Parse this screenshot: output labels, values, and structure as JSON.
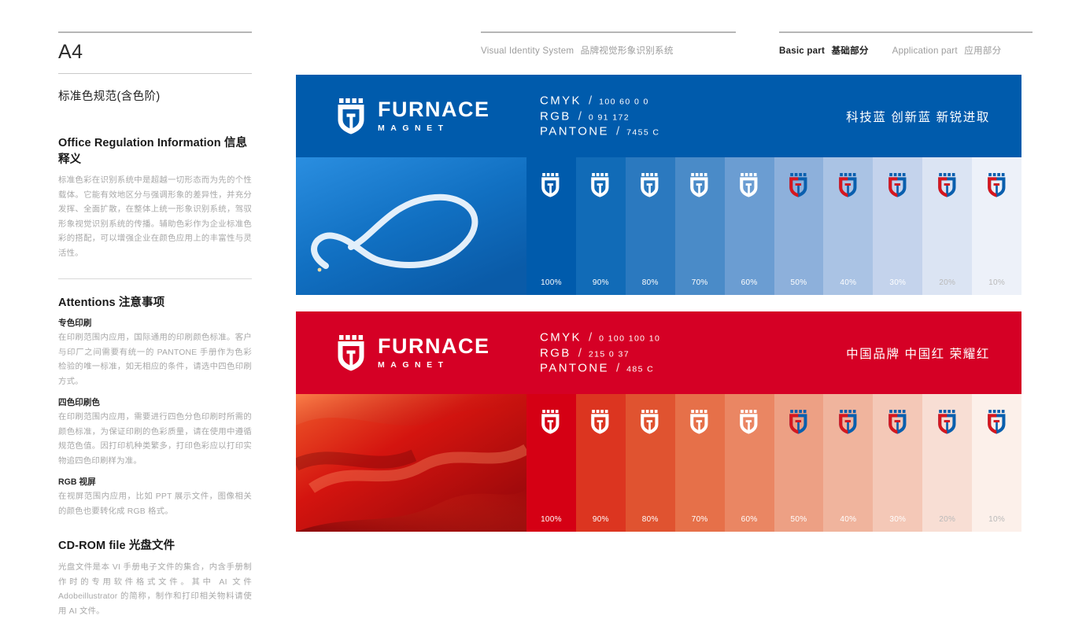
{
  "left": {
    "page_size": "A4",
    "section_title": "标准色规范(含色阶)",
    "info": {
      "heading_en": "Office Regulation Information",
      "heading_cn": "信息释义",
      "body": "标准色彩在识别系统中是超越一切形态而为先的个性载体。它能有效地区分与强调形象的差异性，并充分发挥、全面扩散，在整体上统一形象识别系统，驾驭形象视觉识别系统的传播。辅助色彩作为企业标准色彩的搭配，可以增强企业在颜色应用上的丰富性与灵活性。"
    },
    "attentions": {
      "heading_en": "Attentions",
      "heading_cn": "注意事项",
      "items": [
        {
          "title": "专色印刷",
          "body": "在印刷范围内应用，国际通用的印刷颜色标准。客户与印厂之间需要有统一的 PANTONE 手册作为色彩检验的唯一标准，如无相应的条件，请选中四色印刷方式。"
        },
        {
          "title": "四色印刷色",
          "body": "在印刷范围内应用，需要进行四色分色印刷时所需的颜色标准，为保证印刷的色彩质量，请在使用中遵循规范色值。因打印机种类繁多，打印色彩应以打印实物追四色印刷样为准。"
        },
        {
          "title": "RGB 视屏",
          "body": "在视屏范围内应用，比如 PPT 展示文件，图像相关的颜色也要转化成 RGB 格式。"
        }
      ]
    },
    "cdrom": {
      "heading_en": "CD-ROM file",
      "heading_cn": "光盘文件",
      "body": "光盘文件是本 VI 手册电子文件的集合，内含手册制作时的专用软件格式文件。其中 AI 文件 Adobeillustrator 的简称，制作和打印相关物料请使用 AI 文件。"
    }
  },
  "nav": {
    "left_group": [
      {
        "en": "Visual Identity System",
        "cn": "品牌视觉形象识别系统",
        "active": false
      }
    ],
    "right_group": [
      {
        "en": "Basic part",
        "cn": "基础部分",
        "active": true
      },
      {
        "en": "Application part",
        "cn": "应用部分",
        "active": false
      }
    ]
  },
  "logo": {
    "wordmark_top": "FURNACE",
    "wordmark_bottom": "MAGNET"
  },
  "panels": [
    {
      "id": "blue",
      "base_color": "#005bac",
      "photo_alt": "airplane smoke trail infinity loop in blue sky",
      "specs": [
        {
          "key": "CMYK",
          "sep": "/",
          "value": "100  60  0  0"
        },
        {
          "key": "RGB",
          "sep": "/",
          "value": "0  91  172"
        },
        {
          "key": "PANTONE",
          "sep": "/",
          "value": "7455 C"
        }
      ],
      "tagline": "科技蓝 创新蓝 新锐进取",
      "swatches": [
        {
          "pct": "100%",
          "color": "#005bac",
          "logo": "white",
          "label_dim": false
        },
        {
          "pct": "90%",
          "color": "#116bb7",
          "logo": "white",
          "label_dim": false
        },
        {
          "pct": "80%",
          "color": "#2b79bf",
          "logo": "white",
          "label_dim": false
        },
        {
          "pct": "70%",
          "color": "#4a8bc8",
          "logo": "white",
          "label_dim": false
        },
        {
          "pct": "60%",
          "color": "#6b9dd2",
          "logo": "white",
          "label_dim": false
        },
        {
          "pct": "50%",
          "color": "#8db0db",
          "logo": "color",
          "label_dim": false
        },
        {
          "pct": "40%",
          "color": "#aac3e4",
          "logo": "color",
          "label_dim": false
        },
        {
          "pct": "30%",
          "color": "#c4d3ec",
          "logo": "color",
          "label_dim": false
        },
        {
          "pct": "20%",
          "color": "#dbe4f3",
          "logo": "color",
          "label_dim": true
        },
        {
          "pct": "10%",
          "color": "#edf1f9",
          "logo": "color",
          "label_dim": true
        }
      ]
    },
    {
      "id": "red",
      "base_color": "#d50025",
      "photo_alt": "red silk fabric drapery",
      "specs": [
        {
          "key": "CMYK",
          "sep": "/",
          "value": "0  100  100  10"
        },
        {
          "key": "RGB",
          "sep": "/",
          "value": "215  0  37"
        },
        {
          "key": "PANTONE",
          "sep": "/",
          "value": "485 C"
        }
      ],
      "tagline": "中国品牌 中国红 荣耀红",
      "swatches": [
        {
          "pct": "100%",
          "color": "#d50014",
          "logo": "white",
          "label_dim": false
        },
        {
          "pct": "90%",
          "color": "#dc3520",
          "logo": "white",
          "label_dim": false
        },
        {
          "pct": "80%",
          "color": "#e05330",
          "logo": "white",
          "label_dim": false
        },
        {
          "pct": "70%",
          "color": "#e67049",
          "logo": "white",
          "label_dim": false
        },
        {
          "pct": "60%",
          "color": "#ea8663",
          "logo": "white",
          "label_dim": false
        },
        {
          "pct": "50%",
          "color": "#eda084",
          "logo": "color",
          "label_dim": false
        },
        {
          "pct": "40%",
          "color": "#f0b49d",
          "logo": "color",
          "label_dim": false
        },
        {
          "pct": "30%",
          "color": "#f4c8b7",
          "logo": "color",
          "label_dim": false
        },
        {
          "pct": "20%",
          "color": "#f8ded4",
          "logo": "color",
          "label_dim": true
        },
        {
          "pct": "10%",
          "color": "#fcf0ea",
          "logo": "color",
          "label_dim": true
        }
      ]
    }
  ]
}
